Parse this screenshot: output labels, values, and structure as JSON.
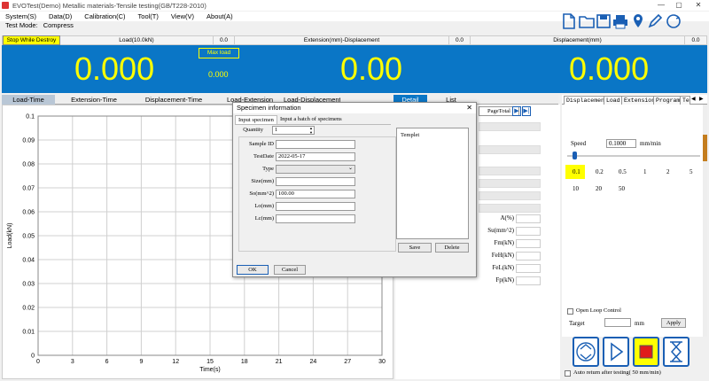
{
  "window": {
    "title": "EVOTest(Demo) Metallic materials-Tensile testing(GB/T228-2010)"
  },
  "menu": [
    "System(S)",
    "Data(D)",
    "Calibration(C)",
    "Tool(T)",
    "View(V)",
    "About(A)"
  ],
  "test_mode": {
    "label": "Test Mode:",
    "value": "Compress"
  },
  "header": {
    "stop_label": "Stop While Destroy",
    "load_label": "Load(10.0kN)",
    "load_val": "0.0",
    "ext_label": "Extension(mm)-Displacement",
    "ext_val": "0.0",
    "disp_label": "Displacement(mm)",
    "disp_val": "0.0"
  },
  "display": {
    "load": "0.000",
    "extension": "0.00",
    "displacement": "0.000",
    "max_load_label": "Max load",
    "max_load_value": "0.000"
  },
  "tabs": [
    "Load-Time",
    "Extension-Time",
    "Displacement-Time",
    "Load-Extension",
    "Load-Displacement",
    "Detail",
    "List"
  ],
  "chart_data": {
    "type": "line",
    "title": "",
    "xlabel": "Time(s)",
    "ylabel": "Load(kN)",
    "xlim": [
      0,
      30
    ],
    "ylim": [
      0,
      0.1
    ],
    "xticks": [
      0,
      3,
      6,
      9,
      12,
      15,
      18,
      21,
      24,
      27,
      30
    ],
    "yticks": [
      0,
      0.01,
      0.02,
      0.03,
      0.04,
      0.05,
      0.06,
      0.07,
      0.08,
      0.09,
      0.1
    ],
    "ytick_labels": [
      "0",
      "0.01",
      "0.02",
      "0.03",
      "0.04",
      "0.05",
      "0.06",
      "0.07",
      "0.08",
      "0.09",
      "0.1"
    ],
    "grid": true,
    "series": []
  },
  "middle": {
    "page_total": "PageTotal",
    "labels": [
      "A(%)",
      "Su(mm^2)",
      "Fm(kN)",
      "FeH(kN)",
      "FeL(kN)",
      "Fp(kN)"
    ]
  },
  "right": {
    "tabs": [
      "Displacement",
      "Load",
      "Extension",
      "Program",
      "Te"
    ],
    "speed_label": "Speed",
    "speed_value": "0.1000",
    "speed_unit": "mm/min",
    "speed_presets": [
      "0.1",
      "0.2",
      "0.5",
      "1",
      "2",
      "5",
      "10",
      "20",
      "50"
    ],
    "open_loop": "Open Loop Control",
    "target_label": "Target",
    "target_unit": "mm",
    "apply": "Apply",
    "auto_return": "Auto return after testing( 50  mm/min)"
  },
  "dialog": {
    "title": "Specimen information",
    "tab1": "Input specimen",
    "tab2": "Input a batch of specimens",
    "quantity_label": "Quantity",
    "quantity_value": "1",
    "fields": [
      {
        "label": "Sample ID",
        "value": ""
      },
      {
        "label": "TestDate",
        "value": "2022-05-17"
      },
      {
        "label": "Type",
        "value": ""
      },
      {
        "label": "Size(mm)",
        "value": ""
      },
      {
        "label": "So(mm^2)",
        "value": "100.00"
      },
      {
        "label": "Lo(mm)",
        "value": ""
      },
      {
        "label": "Lc(mm)",
        "value": ""
      }
    ],
    "templet": "Templet",
    "save": "Save",
    "delete": "Delete",
    "ok": "OK",
    "cancel": "Cancel"
  },
  "colors": {
    "display_bg": "#0a76c6",
    "digits": "#ffff00",
    "accent": "#1a5fb4"
  }
}
